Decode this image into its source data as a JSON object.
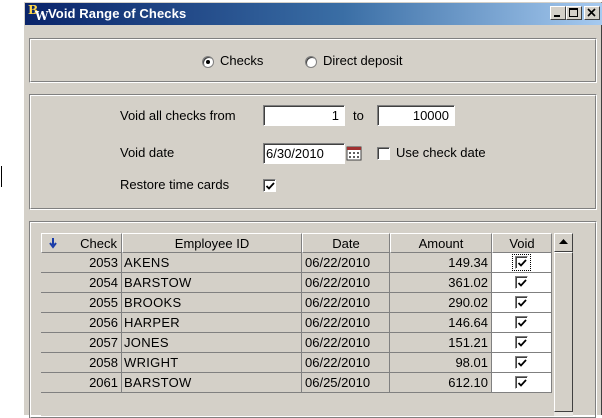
{
  "window": {
    "title": "Void Range of Checks",
    "logo_b": "B",
    "logo_w": "W"
  },
  "type_selector": {
    "checks_label": "Checks",
    "direct_deposit_label": "Direct deposit",
    "selected": "checks"
  },
  "options": {
    "void_from_label": "Void all checks from",
    "from_value": "1",
    "to_label": "to",
    "to_value": "10000",
    "void_date_label": "Void date",
    "void_date_value": "6/30/2010",
    "use_check_date_label": "Use check date",
    "use_check_date_checked": false,
    "restore_time_cards_label": "Restore time cards",
    "restore_time_cards_checked": true
  },
  "grid": {
    "columns": [
      "Check",
      "Employee ID",
      "Date",
      "Amount",
      "Void"
    ],
    "sorted_column": "Check",
    "rows": [
      {
        "check": "2053",
        "employee": "AKENS",
        "date": "06/22/2010",
        "amount": "149.34",
        "void": true
      },
      {
        "check": "2054",
        "employee": "BARSTOW",
        "date": "06/22/2010",
        "amount": "361.02",
        "void": true
      },
      {
        "check": "2055",
        "employee": "BROOKS",
        "date": "06/22/2010",
        "amount": "290.02",
        "void": true
      },
      {
        "check": "2056",
        "employee": "HARPER",
        "date": "06/22/2010",
        "amount": "146.64",
        "void": true
      },
      {
        "check": "2057",
        "employee": "JONES",
        "date": "06/22/2010",
        "amount": "151.21",
        "void": true
      },
      {
        "check": "2058",
        "employee": "WRIGHT",
        "date": "06/22/2010",
        "amount": "98.01",
        "void": true
      },
      {
        "check": "2061",
        "employee": "BARSTOW",
        "date": "06/25/2010",
        "amount": "612.10",
        "void": true
      }
    ]
  },
  "colors": {
    "title_start": "#0a246a",
    "title_end": "#a6caf0",
    "face": "#d4d0c8"
  }
}
